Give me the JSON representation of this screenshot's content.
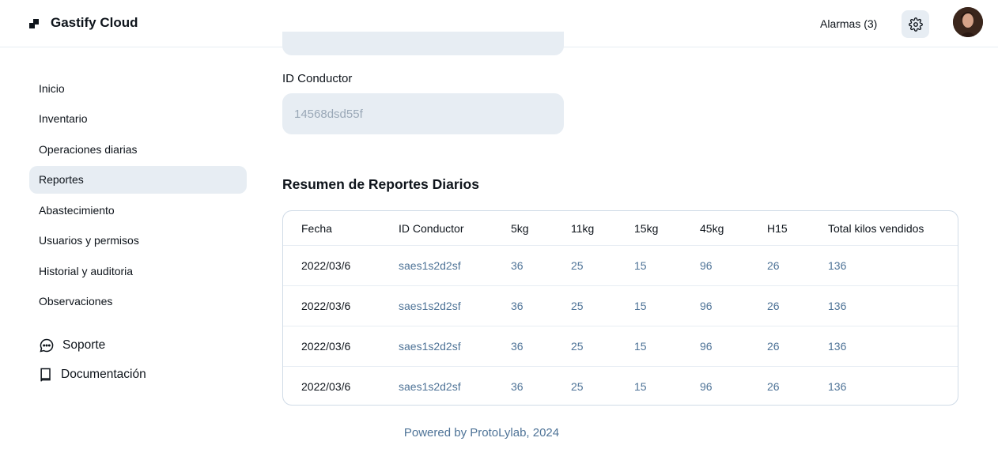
{
  "header": {
    "app_title": "Gastify Cloud",
    "alarms_label": "Alarmas (3)"
  },
  "sidebar": {
    "items": [
      {
        "label": "Inicio",
        "active": false
      },
      {
        "label": "Inventario",
        "active": false
      },
      {
        "label": "Operaciones diarias",
        "active": false
      },
      {
        "label": "Reportes",
        "active": true
      },
      {
        "label": "Abastecimiento",
        "active": false
      },
      {
        "label": "Usuarios y permisos",
        "active": false
      },
      {
        "label": "Historial y auditoria",
        "active": false
      },
      {
        "label": "Observaciones",
        "active": false
      }
    ],
    "support_label": "Soporte",
    "docs_label": "Documentación"
  },
  "form": {
    "driver_id_label": "ID Conductor",
    "driver_id_placeholder": "14568dsd55f"
  },
  "summary": {
    "title": "Resumen de Reportes Diarios",
    "columns": [
      "Fecha",
      "ID Conductor",
      "5kg",
      "11kg",
      "15kg",
      "45kg",
      "H15",
      "Total kilos vendidos"
    ],
    "rows": [
      [
        "2022/03/6",
        "saes1s2d2sf",
        "36",
        "25",
        "15",
        "96",
        "26",
        "136"
      ],
      [
        "2022/03/6",
        "saes1s2d2sf",
        "36",
        "25",
        "15",
        "96",
        "26",
        "136"
      ],
      [
        "2022/03/6",
        "saes1s2d2sf",
        "36",
        "25",
        "15",
        "96",
        "26",
        "136"
      ],
      [
        "2022/03/6",
        "saes1s2d2sf",
        "36",
        "25",
        "15",
        "96",
        "26",
        "136"
      ]
    ]
  },
  "footer": {
    "text": "Powered by ProtoLylab, 2024"
  }
}
